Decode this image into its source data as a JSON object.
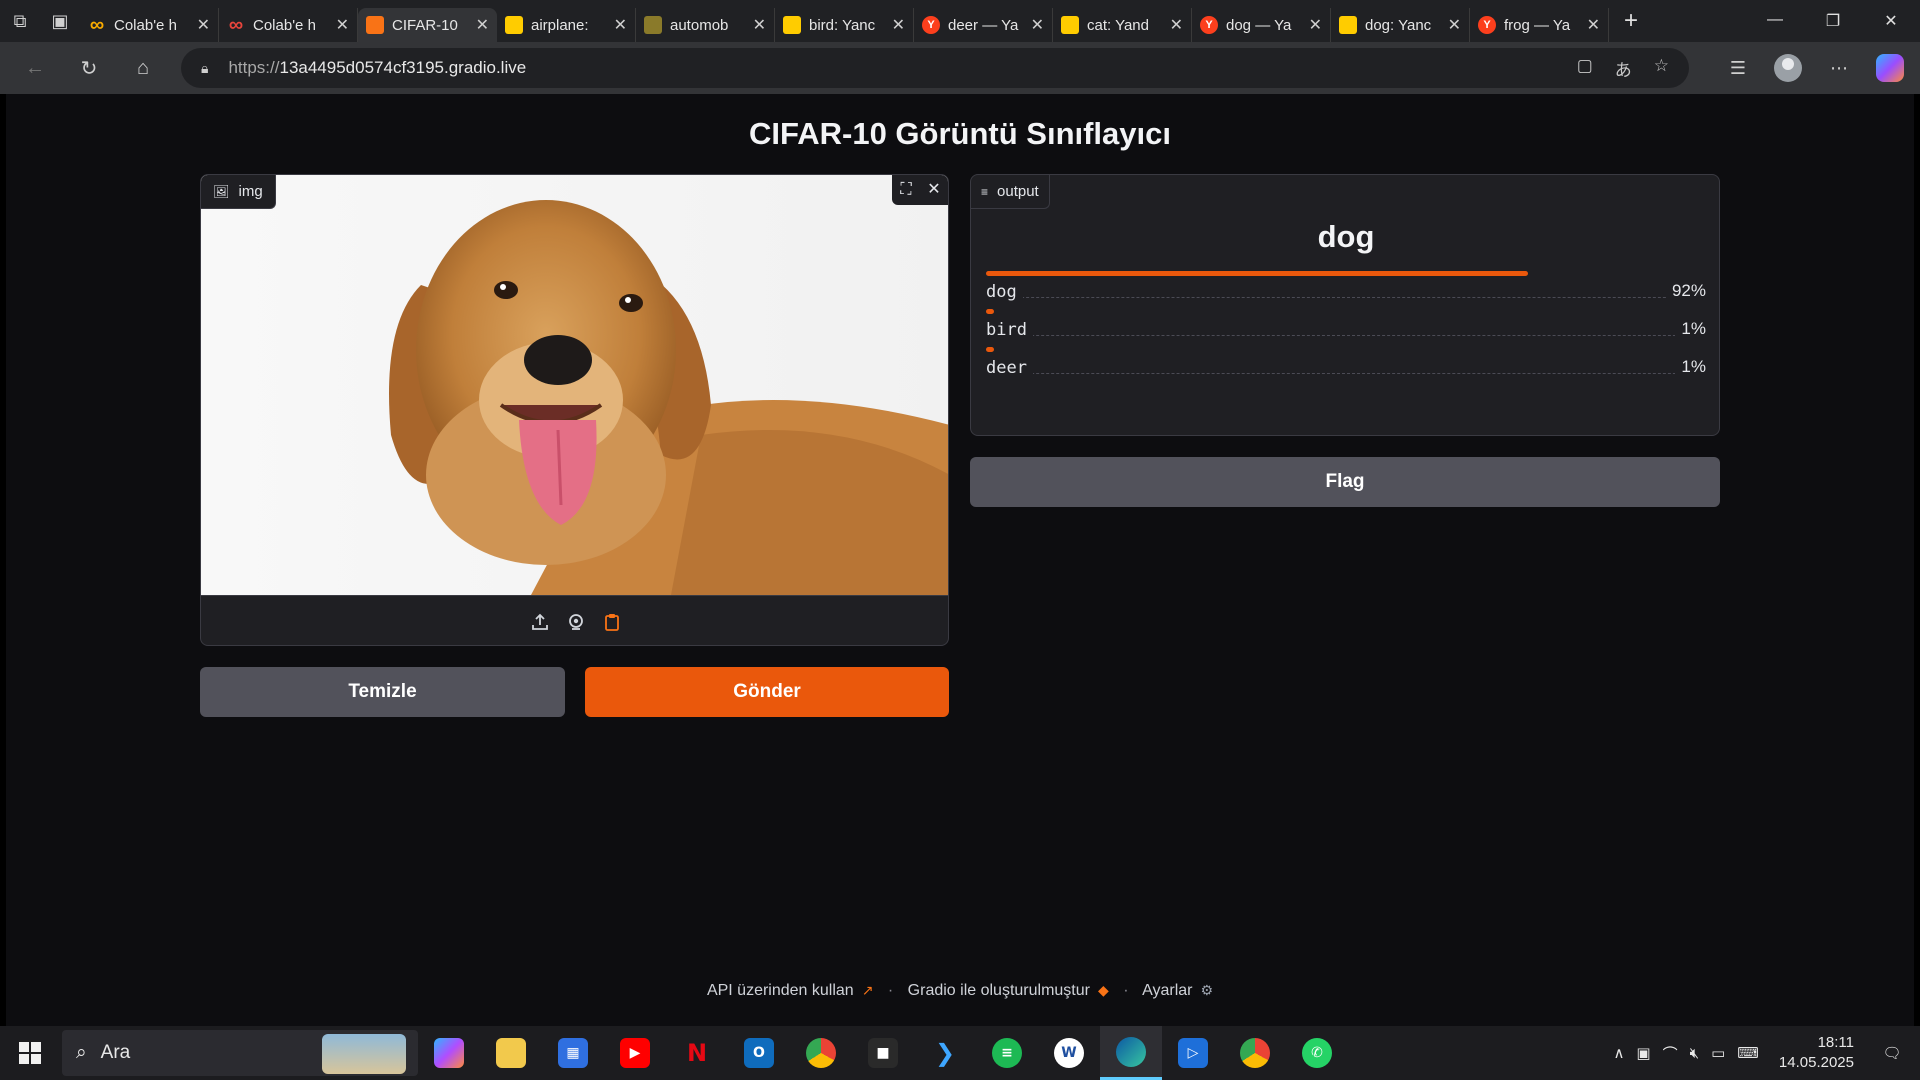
{
  "browser": {
    "tabs": [
      {
        "title": "Colab'e h",
        "icon": "colab-icon",
        "color": "#f9ab00",
        "active": false
      },
      {
        "title": "Colab'e h",
        "icon": "colab-icon",
        "color": "#e8453c",
        "active": false
      },
      {
        "title": "CIFAR-10",
        "icon": "gradio-icon",
        "color": "#f97316",
        "active": true
      },
      {
        "title": "airplane:",
        "icon": "yandex-images-icon",
        "color": "#ffcc00",
        "active": false
      },
      {
        "title": "automob",
        "icon": "yandex-images-icon",
        "color": "#8a7a2a",
        "active": false
      },
      {
        "title": "bird: Yanc",
        "icon": "yandex-images-icon",
        "color": "#ffcc00",
        "active": false
      },
      {
        "title": "deer — Ya",
        "icon": "yandex-icon",
        "color": "#fc3f1d",
        "active": false
      },
      {
        "title": "cat: Yand",
        "icon": "yandex-images-icon",
        "color": "#ffcc00",
        "active": false
      },
      {
        "title": "dog — Ya",
        "icon": "yandex-icon",
        "color": "#fc3f1d",
        "active": false
      },
      {
        "title": "dog: Yanc",
        "icon": "yandex-images-icon",
        "color": "#ffcc00",
        "active": false
      },
      {
        "title": "frog — Ya",
        "icon": "yandex-icon",
        "color": "#fc3f1d",
        "active": false
      }
    ],
    "url_protocol": "https://",
    "url_host": "13a4495d0574cf3195.gradio.live"
  },
  "app": {
    "title": "CIFAR-10 Görüntü Sınıflayıcı",
    "input_label": "img",
    "output_label": "output",
    "clear_label": "Temizle",
    "submit_label": "Gönder",
    "flag_label": "Flag",
    "top_prediction": "dog",
    "confidences": [
      {
        "label": "dog",
        "value": 0.92,
        "display": "92%"
      },
      {
        "label": "bird",
        "value": 0.01,
        "display": "1%"
      },
      {
        "label": "deer",
        "value": 0.01,
        "display": "1%"
      }
    ],
    "accent_color": "#ea580c"
  },
  "footer": {
    "api_link": "API üzerinden kullan",
    "built_with": "Gradio ile oluşturulmuştur",
    "settings": "Ayarlar"
  },
  "taskbar": {
    "search_placeholder": "Ara",
    "time": "18:11",
    "date": "14.05.2025"
  }
}
